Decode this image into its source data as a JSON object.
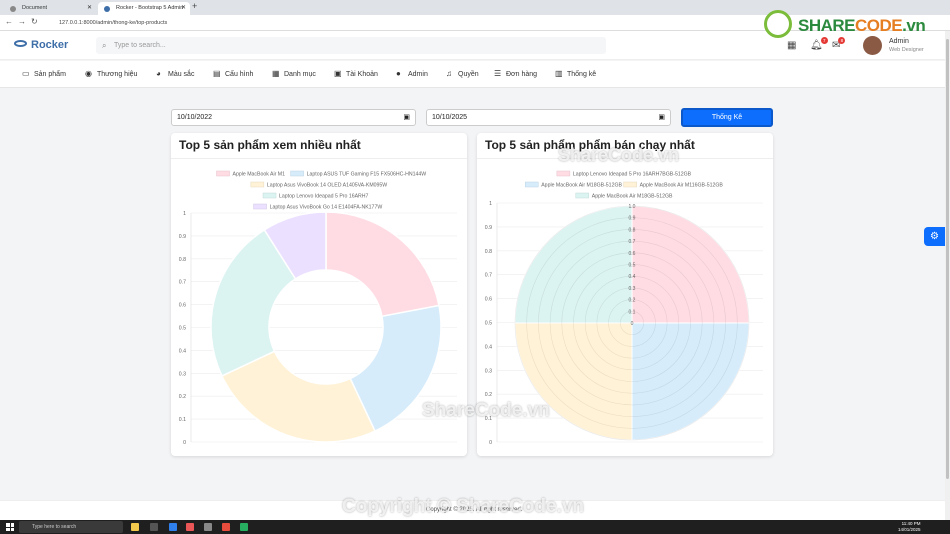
{
  "browser": {
    "tabs": [
      {
        "label": "Document"
      },
      {
        "label": "Rocker - Bootstrap 5 Admin D..."
      }
    ],
    "url": "127.0.0.1:8000/admin/thong-ke/top-products"
  },
  "header": {
    "logo": "Rocker",
    "search_placeholder": "Type to search...",
    "notif_count": "7",
    "msg_count": "8",
    "user_name": "Admin",
    "user_role": "Web Designer"
  },
  "brand_logo": {
    "share": "SHARE",
    "code": "CODE",
    "vn": ".vn"
  },
  "menu": [
    {
      "label": "Sản phẩm",
      "icon": "laptop-icon"
    },
    {
      "label": "Thương hiệu",
      "icon": "brand-icon"
    },
    {
      "label": "Màu sắc",
      "icon": "palette-icon"
    },
    {
      "label": "Cấu hình",
      "icon": "table-icon"
    },
    {
      "label": "Danh mục",
      "icon": "calendar-icon"
    },
    {
      "label": "Tài Khoản",
      "icon": "id-card-icon"
    },
    {
      "label": "Admin",
      "icon": "user-icon"
    },
    {
      "label": "Quyền",
      "icon": "bell-icon"
    },
    {
      "label": "Đơn hàng",
      "icon": "list-icon"
    },
    {
      "label": "Thống kê",
      "icon": "chart-icon"
    }
  ],
  "filters": {
    "start_date": "10/10/2022",
    "end_date": "10/10/2025",
    "submit_label": "Thống Kê"
  },
  "cards": {
    "views_title": "Top 5 sản phẩm xem nhiều nhất",
    "sales_title": "Top 5 sản phẩm phẩm bán chạy nhất"
  },
  "colors": {
    "pink": "#ffdce4",
    "blue": "#d6ecfb",
    "yellow": "#fff2d6",
    "teal": "#dbf3f1",
    "purple": "#ebe0ff",
    "primary": "#0d6efd"
  },
  "chart_data": [
    {
      "type": "doughnut",
      "title": "Top 5 sản phẩm xem nhiều nhất",
      "legend": [
        "Apple MacBook Air M1",
        "Laptop ASUS TUF Gaming F15 FX506HC-HN144W",
        "Laptop Asus VivoBook 14 OLED A1405VA-KM095W",
        "Laptop Lenovo Ideapad 5 Pro 16ARH7",
        "Laptop Asus VivoBook Go 14 E1404FA-NK177W"
      ],
      "values": [
        22,
        21,
        25,
        23,
        9
      ],
      "colors": [
        "#ffdce4",
        "#d6ecfb",
        "#fff2d6",
        "#dbf3f1",
        "#ebe0ff"
      ],
      "y_ticks": [
        "1",
        "0.9",
        "0.8",
        "0.7",
        "0.6",
        "0.5",
        "0.4",
        "0.3",
        "0.2",
        "0.1",
        "0"
      ],
      "legend_position": "top"
    },
    {
      "type": "polarArea",
      "title": "Top 5 sản phẩm phẩm bán chạy nhất",
      "legend": [
        "Laptop Lenovo Ideapad 5 Pro 16ARH7BGB-512GB",
        "Apple MacBook Air M18GB-512GB",
        "Apple MacBook Air M116GB-512GB",
        "Apple MacBook Air M18GB-512GB"
      ],
      "values": [
        1,
        1,
        1,
        1
      ],
      "colors": [
        "#ffdce4",
        "#d6ecfb",
        "#fff2d6",
        "#dbf3f1"
      ],
      "y_ticks": [
        "1",
        "0.9",
        "0.8",
        "0.7",
        "0.6",
        "0.5",
        "0.4",
        "0.3",
        "0.2",
        "0.1",
        "0"
      ],
      "r_ticks": [
        "1.0",
        "0.9",
        "0.8",
        "0.7",
        "0.6",
        "0.5",
        "0.4",
        "0.3",
        "0.2",
        "0.1",
        "0"
      ],
      "legend_position": "top"
    }
  ],
  "watermarks": {
    "top": "ShareCode.vn",
    "middle": "ShareCode.vn",
    "bottom": "Copyright © ShareCode.vn"
  },
  "footer": {
    "text": "Copyright © 2025. All right reserved."
  },
  "taskbar": {
    "search_placeholder": "Type here to search",
    "time": "11:40 PM",
    "date": "14/01/2025"
  }
}
